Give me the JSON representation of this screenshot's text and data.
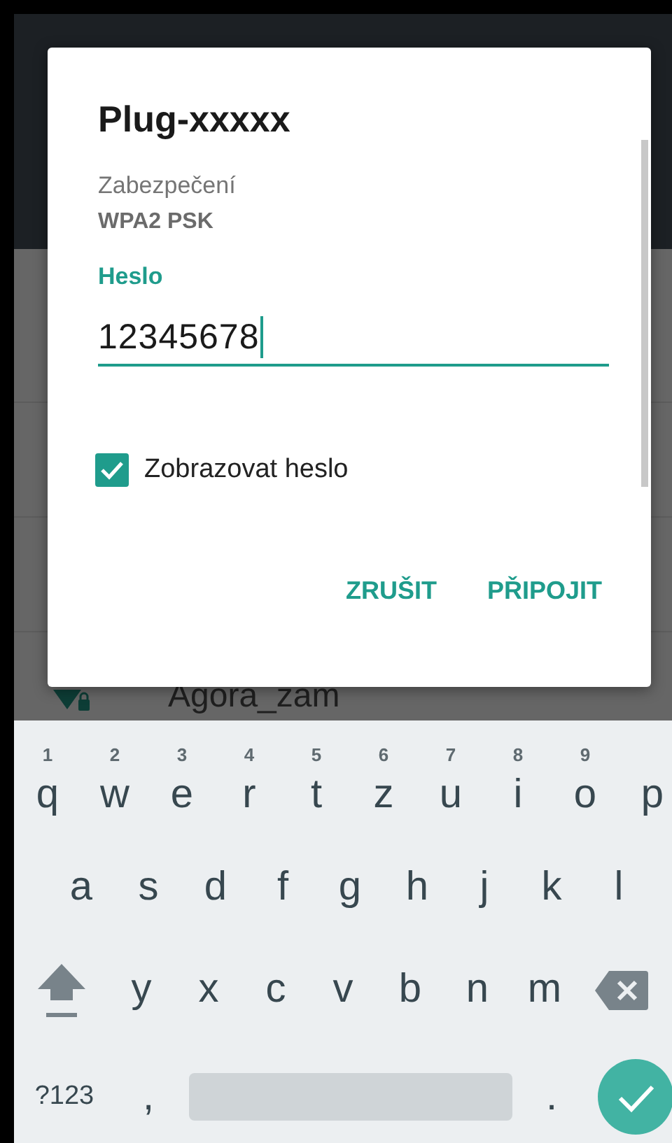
{
  "background_list": {
    "partial_item": "Agora_zam"
  },
  "dialog": {
    "title": "Plug-xxxxx",
    "security_label": "Zabezpečení",
    "security_value": "WPA2 PSK",
    "password_label": "Heslo",
    "password_value": "12345678",
    "show_password": {
      "label": "Zobrazovat heslo",
      "checked": true
    },
    "buttons": [
      "ZRUŠIT",
      "PŘIPOJIT"
    ]
  },
  "keyboard": {
    "key_rows": [
      {
        "keys": [
          {
            "kind": "letter",
            "key": "q",
            "hint": "1"
          },
          {
            "kind": "letter",
            "key": "w",
            "hint": "2"
          },
          {
            "kind": "letter",
            "key": "e",
            "hint": "3"
          },
          {
            "kind": "letter",
            "key": "r",
            "hint": "4"
          },
          {
            "kind": "letter",
            "key": "t",
            "hint": "5"
          },
          {
            "kind": "letter",
            "key": "z",
            "hint": "6"
          },
          {
            "kind": "letter",
            "key": "u",
            "hint": "7"
          },
          {
            "kind": "letter",
            "key": "i",
            "hint": "8"
          },
          {
            "kind": "letter",
            "key": "o",
            "hint": "9"
          },
          {
            "kind": "letter",
            "key": "p"
          }
        ]
      },
      {
        "keys": [
          {
            "kind": "letter",
            "key": "a"
          },
          {
            "kind": "letter",
            "key": "s"
          },
          {
            "kind": "letter",
            "key": "d"
          },
          {
            "kind": "letter",
            "key": "f"
          },
          {
            "kind": "letter",
            "key": "g"
          },
          {
            "kind": "letter",
            "key": "h"
          },
          {
            "kind": "letter",
            "key": "j"
          },
          {
            "kind": "letter",
            "key": "k"
          },
          {
            "kind": "letter",
            "key": "l"
          }
        ]
      },
      {
        "keys": [
          {
            "kind": "shift"
          },
          {
            "kind": "letter",
            "key": "y"
          },
          {
            "kind": "letter",
            "key": "x"
          },
          {
            "kind": "letter",
            "key": "c"
          },
          {
            "kind": "letter",
            "key": "v"
          },
          {
            "kind": "letter",
            "key": "b"
          },
          {
            "kind": "letter",
            "key": "n"
          },
          {
            "kind": "letter",
            "key": "m"
          },
          {
            "kind": "backspace"
          }
        ]
      },
      {
        "keys": [
          {
            "kind": "symbols",
            "key": "?123"
          },
          {
            "kind": "letter",
            "key": ","
          },
          {
            "kind": "space"
          },
          {
            "kind": "letter",
            "key": "."
          },
          {
            "kind": "enter"
          }
        ]
      }
    ]
  }
}
